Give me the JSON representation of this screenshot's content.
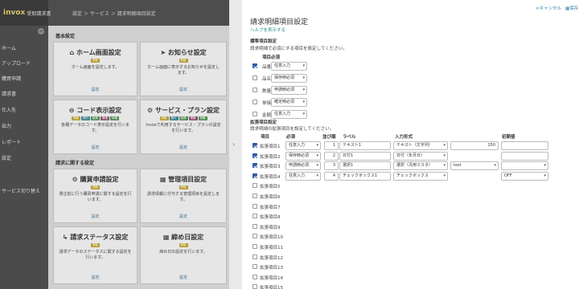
{
  "app": {
    "logo": "invox",
    "logo_sub": "受取請求書",
    "breadcrumb": "設定 ＞ サービス ＞ 請求明細項目設定"
  },
  "sidebar": {
    "items": [
      {
        "label": "ホーム"
      },
      {
        "label": "アップロード"
      },
      {
        "label": "購買申請"
      },
      {
        "label": "請求書"
      },
      {
        "label": "仕入先"
      },
      {
        "label": "出力"
      },
      {
        "label": "レポート"
      },
      {
        "label": "設定"
      },
      {
        "label": "サービス切り替え"
      }
    ]
  },
  "main": {
    "sections": [
      {
        "title": "基本設定"
      },
      {
        "title": "請求に関する設定"
      }
    ],
    "cards": [
      {
        "icon": "home-icon",
        "title": "ホーム画面設定",
        "tags": [
          {
            "label": "受取",
            "color": "y"
          }
        ],
        "desc": "ホーム画面を設定します。",
        "link": "設定"
      },
      {
        "icon": "megaphone-icon",
        "title": "お知らせ設定",
        "tags": [
          {
            "label": "受取",
            "color": "y"
          }
        ],
        "desc": "ホーム画面に表示するお知らせを設定します。",
        "link": "設定"
      },
      {
        "icon": "minus-circle-icon",
        "title": "コード表示設定",
        "tags": [
          {
            "label": "受取",
            "color": "y"
          },
          {
            "label": "発行",
            "color": "b"
          },
          {
            "label": "経費",
            "color": "g"
          },
          {
            "label": "電帳",
            "color": "r"
          },
          {
            "label": "債権",
            "color": "g"
          }
        ],
        "desc": "各種データのコード表示設定を行います。",
        "link": "設定"
      },
      {
        "icon": "gear-icon",
        "title": "サービス・プラン設定",
        "tags": [
          {
            "label": "受取",
            "color": "y"
          },
          {
            "label": "発行",
            "color": "b"
          },
          {
            "label": "経費",
            "color": "g"
          },
          {
            "label": "電帳",
            "color": "r"
          },
          {
            "label": "債権",
            "color": "g"
          }
        ],
        "desc": "invoxで利用するサービス・プランの設定を行います。",
        "link": "設定"
      },
      {
        "icon": "gears-icon",
        "title": "購買申請設定",
        "tags": [
          {
            "label": "受取",
            "color": "y"
          }
        ],
        "desc": "発注前に行う購買申請に関する設定を行います。",
        "link": "設定"
      },
      {
        "icon": "sitemap-icon",
        "title": "管理項目設定",
        "tags": [
          {
            "label": "受取",
            "color": "y"
          }
        ],
        "desc": "請求情報に付与する管理項目を設定します。",
        "link": "設定"
      },
      {
        "icon": "flow-icon",
        "title": "請求ステータス設定",
        "tags": [
          {
            "label": "受取",
            "color": "y"
          }
        ],
        "desc": "請求データのステータスに関する設定を行います。",
        "link": "設定"
      },
      {
        "icon": "calendar-icon",
        "title": "締め日設定",
        "tags": [
          {
            "label": "受取",
            "color": "y"
          }
        ],
        "desc": "締め日の設定を行います。",
        "link": "設定"
      }
    ]
  },
  "panel": {
    "cancel_label": "キャンセル",
    "save_label": "保存",
    "title": "請求明細項目設定",
    "help_link": "ヘルプを表示する",
    "standard": {
      "heading": "標準項目設定",
      "desc": "請求明細で必須にする項目を設定してください。",
      "col_item": "項目",
      "col_required": "必須",
      "rows": [
        {
          "checked": true,
          "label": "品番",
          "value": "任意入力"
        },
        {
          "checked": false,
          "label": "品名",
          "value": "保存時必須"
        },
        {
          "checked": false,
          "label": "数量",
          "value": "申請時必須"
        },
        {
          "checked": false,
          "label": "単価",
          "value": "確定時必須"
        },
        {
          "checked": false,
          "label": "金額",
          "value": "任意入力"
        }
      ]
    },
    "extended": {
      "heading": "拡張項目設定",
      "desc": "請求明細の拡張項目を設定してください。",
      "headers": {
        "item": "項目",
        "required": "必須",
        "order": "並び順",
        "label": "ラベル",
        "input_type": "入力形式",
        "default": "初期値"
      },
      "rows": [
        {
          "checked": true,
          "label": "拡張項目1",
          "required": "任意入力",
          "order": "1",
          "name": "テキスト1",
          "type": "テキスト（文字列）",
          "extra": "250",
          "default": ""
        },
        {
          "checked": true,
          "label": "拡張項目2",
          "required": "保存時必須",
          "order": "2",
          "name": "日付1",
          "type": "日付（年月日）",
          "extra": null,
          "default": ""
        },
        {
          "checked": true,
          "label": "拡張項目3",
          "required": "申請時必須",
          "order": "3",
          "name": "選択1",
          "type": "選択（汎用マスタ）",
          "extra": "test",
          "default": ""
        },
        {
          "checked": true,
          "label": "拡張項目4",
          "required": "任意入力",
          "order": "4",
          "name": "チェックボックス1",
          "type": "チェックボックス",
          "extra": null,
          "default": "OFF"
        },
        {
          "checked": false,
          "label": "拡張項目5"
        },
        {
          "checked": false,
          "label": "拡張項目6"
        },
        {
          "checked": false,
          "label": "拡張項目7"
        },
        {
          "checked": false,
          "label": "拡張項目8"
        },
        {
          "checked": false,
          "label": "拡張項目9"
        },
        {
          "checked": false,
          "label": "拡張項目10"
        },
        {
          "checked": false,
          "label": "拡張項目11"
        },
        {
          "checked": false,
          "label": "拡張項目12"
        },
        {
          "checked": false,
          "label": "拡張項目13"
        },
        {
          "checked": false,
          "label": "拡張項目14"
        },
        {
          "checked": false,
          "label": "拡張項目15"
        }
      ]
    }
  },
  "colors": {
    "accent": "#2a8f8f",
    "checkbox": "#2e5aa6",
    "sidebar": "#4b4b4b"
  }
}
